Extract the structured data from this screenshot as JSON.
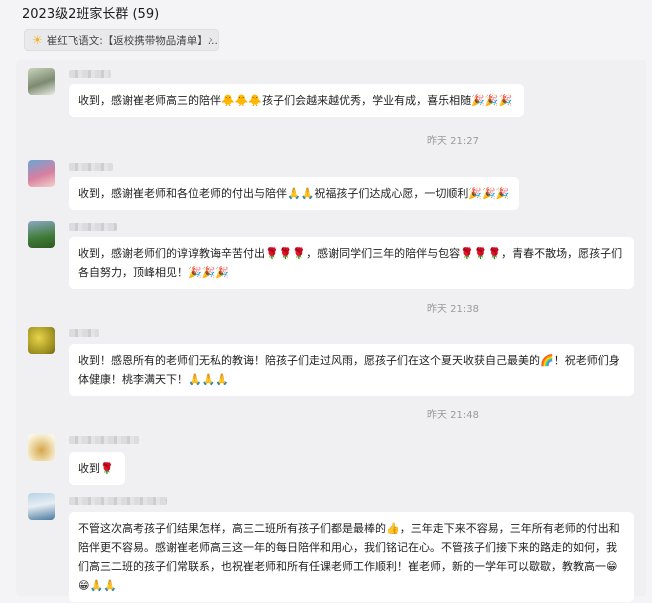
{
  "header": {
    "title": "2023级2班家长群 (59)"
  },
  "pinned": {
    "text": "崔红飞语文:【返校携带物品清单】..."
  },
  "icons": {
    "pin": "sun-icon",
    "chevron": "chevron-right-icon"
  },
  "messages": [
    {
      "text": "收到，感谢崔老师高三的陪伴🐥🐥🐥孩子们会越来越优秀，学业有成，喜乐相随🎉🎉🎉"
    },
    {
      "text": "收到，感谢崔老师和各位老师的付出与陪伴🙏🙏祝福孩子们达成心愿，一切顺利🎉🎉🎉"
    },
    {
      "text": "收到，感谢老师们的谆谆教诲辛苦付出🌹🌹🌹，感谢同学们三年的陪伴与包容🌹🌹🌹，青春不散场，愿孩子们各自努力，顶峰相见！🎉🎉🎉"
    },
    {
      "text": "收到！感恩所有的老师们无私的教诲！陪孩子们走过风雨，愿孩子们在这个夏天收获自己最美的🌈！祝老师们身体健康！桃李满天下！🙏🙏🙏"
    },
    {
      "text": "收到🌹"
    },
    {
      "text": "不管这次高考孩子们结果怎样，高三二班所有孩子们都是最棒的👍，三年走下来不容易，三年所有老师的付出和陪伴更不容易。感谢崔老师高三这一年的每日陪伴和用心，我们铭记在心。不管孩子们接下来的路走的如何，我们高三二班的孩子们常联系，也祝崔老师和所有任课老师工作顺利！崔老师，新的一学年可以歇歇，教教高一😁😁🙏🙏"
    }
  ],
  "timestamps": [
    "昨天 21:27",
    "昨天 21:38",
    "昨天 21:48"
  ]
}
